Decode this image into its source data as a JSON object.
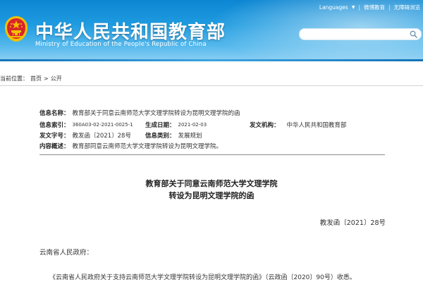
{
  "header": {
    "title": "中华人民共和国教育部",
    "subtitle": "Ministry of Education of the People's Republic of China",
    "languages_label": "Languages",
    "caret": "▼",
    "link_weibo": "微博教育",
    "link_accessible": "无障碍浏览",
    "separator": "|",
    "search_placeholder": ""
  },
  "breadcrumb": {
    "prefix": "当前位置：",
    "home": "首页",
    "separator": ">",
    "section": "公开"
  },
  "meta": {
    "name_label": "信息名称：",
    "name_value": "教育部关于同意云南师范大学文理学院转设为昆明文理学院的函",
    "index_label": "信息索引：",
    "index_value": "360A03-02-2021-0025-1",
    "date_label": "生成日期：",
    "date_value": "2021-02-03",
    "issuer_label": "发文机构：",
    "issuer_value": "中华人民共和国教育部",
    "docno_label": "发文字号：",
    "docno_value": "教发函〔2021〕28号",
    "category_label": "信息类别：",
    "category_value": "发展规划",
    "summary_label": "内容概述：",
    "summary_value": "教育部同意云南师范大学文理学院转设为昆明文理学院。"
  },
  "document": {
    "title_line1": "教育部关于同意云南师范大学文理学院",
    "title_line2": "转设为昆明文理学院的函",
    "doc_number": "教发函〔2021〕28号",
    "addressee": "云南省人民政府：",
    "paragraph1": "《云南省人民政府关于支持云南师范大学文理学院转设为昆明文理学院的函》（云政函〔2020〕90号）收悉。"
  },
  "colors": {
    "header_blue": "#1f9be0",
    "emblem_red": "#d8262c",
    "emblem_gold": "#f2c200"
  }
}
